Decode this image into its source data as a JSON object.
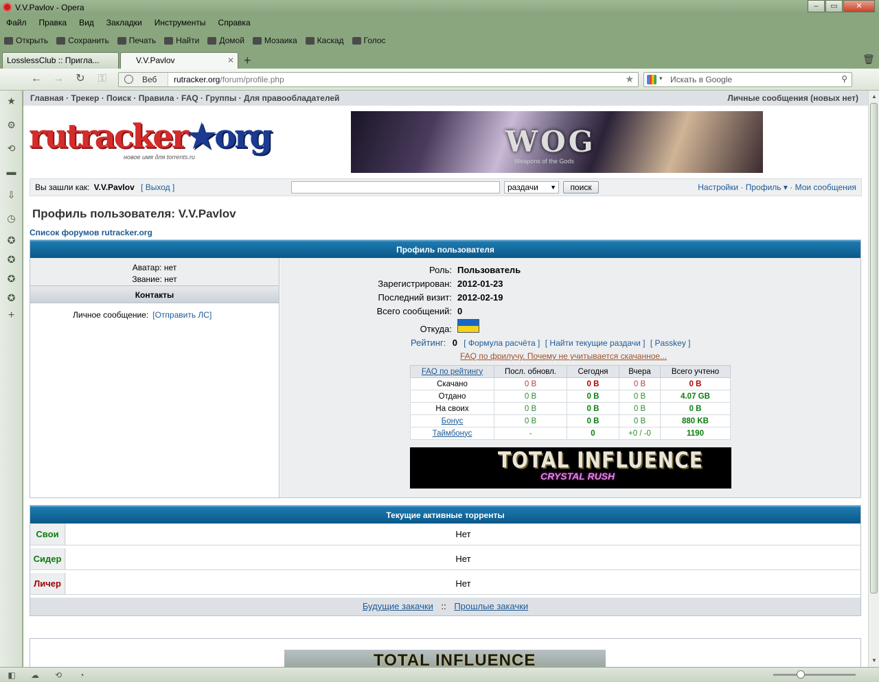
{
  "window": {
    "title": "V.V.Pavlov - Opera"
  },
  "menu": [
    "Файл",
    "Правка",
    "Вид",
    "Закладки",
    "Инструменты",
    "Справка"
  ],
  "toolbar": [
    "Открыть",
    "Сохранить",
    "Печать",
    "Найти",
    "Домой",
    "Мозаика",
    "Каскад",
    "Голос"
  ],
  "tabs": [
    {
      "label": "LosslessClub :: Пригла...",
      "active": false
    },
    {
      "label": "V.V.Pavlov",
      "active": true
    }
  ],
  "address": {
    "mode": "Веб",
    "host": "rutracker.org",
    "path": "/forum/profile.php"
  },
  "search": {
    "placeholder": "Искать в Google"
  },
  "site": {
    "nav_left": "Главная · Трекер · Поиск · Правила · FAQ · Группы · Для правообладателей",
    "nav_right": "Личные сообщения (новых нет)",
    "logo_main": "rutracker",
    "logo_accent": "★org",
    "logo_sub": "новое имя для torrents.ru",
    "banner_text": "WOG",
    "banner_sub": "Weapons of the Gods",
    "login_prefix": "Вы зашли как:",
    "login_user": "V.V.Pavlov",
    "logout": "[ Выход ]",
    "search_select": "раздачи",
    "search_button": "поиск",
    "links_right": "Настройки · Профиль ▾ · Мои сообщения"
  },
  "profile": {
    "page_title": "Профиль пользователя: V.V.Pavlov",
    "forum_link": "Список форумов rutracker.org",
    "header": "Профиль пользователя",
    "avatar": "Аватар: нет",
    "rank": "Звание: нет",
    "contacts": "Контакты",
    "pm_label": "Личное сообщение:",
    "pm_link": "[Отправить ЛС]",
    "fields": [
      {
        "k": "Роль:",
        "v": "Пользователь"
      },
      {
        "k": "Зарегистрирован:",
        "v": "2012-01-23"
      },
      {
        "k": "Последний визит:",
        "v": "2012-02-19"
      },
      {
        "k": "Всего сообщений:",
        "v": "0"
      },
      {
        "k": "Откуда:",
        "v": ""
      }
    ],
    "rating_label": "Рейтинг:",
    "rating_value": "0",
    "rating_links": [
      "[ Формула расчёта ]",
      "[ Найти текущие раздачи ]",
      "[ Passkey ]"
    ],
    "faq_free": "FAQ по фрилучу. Почему не учитывается скачанное..."
  },
  "stats": {
    "headers": [
      "FAQ по рейтингу",
      "Посл. обновл.",
      "Сегодня",
      "Вчера",
      "Всего учтено"
    ],
    "rows": [
      [
        "Скачано",
        "0 B",
        "0 B",
        "0 B",
        "0 B"
      ],
      [
        "Отдано",
        "0 B",
        "0 B",
        "0 B",
        "4.07 GB"
      ],
      [
        "На своих",
        "0 B",
        "0 B",
        "0 B",
        "0 B"
      ],
      [
        "Бонус",
        "0 B",
        "0 B",
        "0 B",
        "880 KB"
      ],
      [
        "Таймбонус",
        "-",
        "0",
        "+0 / -0",
        "1190"
      ]
    ]
  },
  "ad": {
    "title": "TOTAL INFLUENCE",
    "sub": "CRYSTAL RUSH",
    "bottom_title": "TOTAL INFLUENCE"
  },
  "torrents": {
    "header": "Текущие активные торренты",
    "rows": [
      {
        "label": "Свои",
        "value": "Нет",
        "color": "#0a7d0a"
      },
      {
        "label": "Сидер",
        "value": "Нет",
        "color": "#0a7d0a"
      },
      {
        "label": "Личер",
        "value": "Нет",
        "color": "#a00000"
      }
    ],
    "future": "Будущие закачки",
    "sep": "::",
    "past": "Прошлые закачки"
  }
}
